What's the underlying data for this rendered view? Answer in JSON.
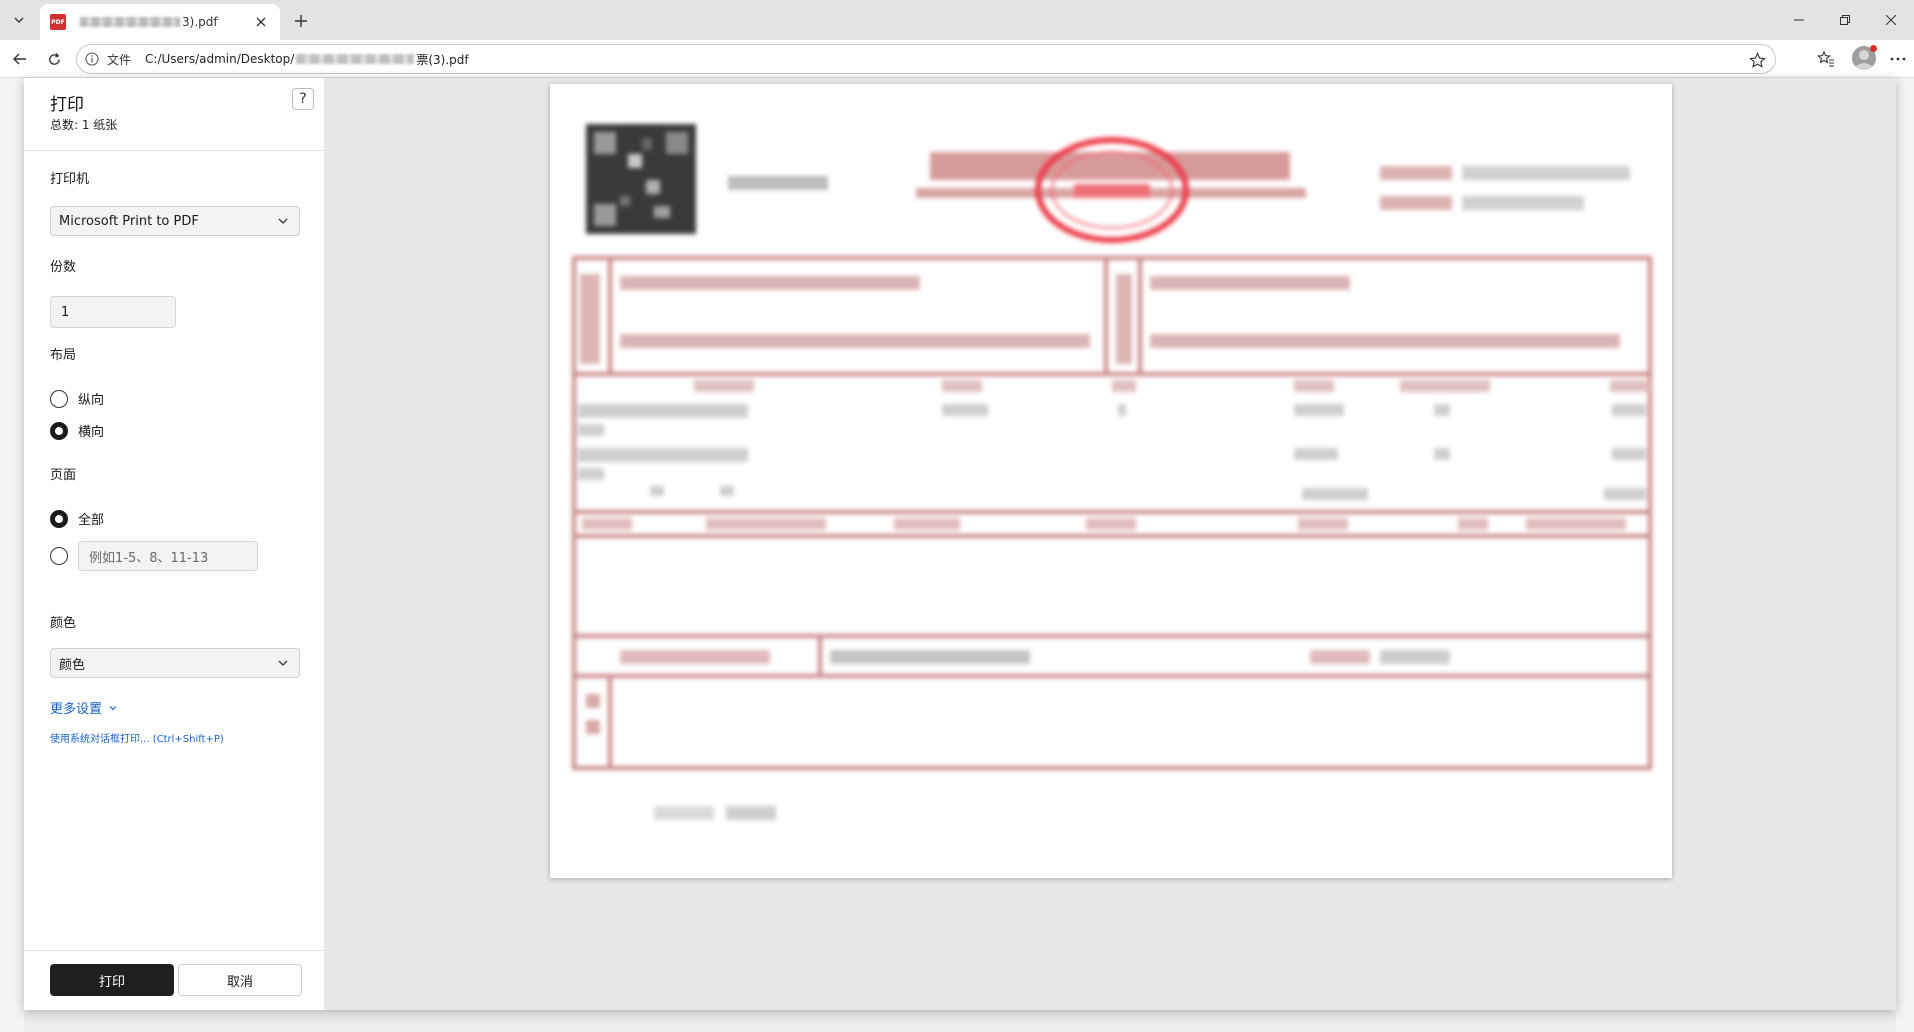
{
  "browser": {
    "tab_title": "3).pdf",
    "address_scheme_label": "文件",
    "address_prefix": "C:/Users/admin/Desktop/",
    "address_suffix": "票(3).pdf"
  },
  "print_panel": {
    "title": "打印",
    "summary": "总数: 1 纸张",
    "help_label": "?",
    "printer_label": "打印机",
    "printer_value": "Microsoft Print to PDF",
    "copies_label": "份数",
    "copies_value": "1",
    "layout_label": "布局",
    "layout_options": [
      {
        "label": "纵向",
        "selected": false
      },
      {
        "label": "横向",
        "selected": true
      }
    ],
    "pages_label": "页面",
    "pages_all_label": "全部",
    "pages_all_selected": true,
    "pages_custom_placeholder": "例如1-5、8、11-13",
    "color_label": "颜色",
    "color_value": "颜色",
    "more_settings": "更多设置",
    "system_dialog": "使用系统对话框打印... (Ctrl+Shift+P)",
    "print_button": "打印",
    "cancel_button": "取消"
  },
  "colors": {
    "accent_link": "#1a62c6",
    "print_button_bg": "#1f1f1f",
    "invoice_red": "#c97b7b",
    "stamp_red": "#e63946"
  }
}
